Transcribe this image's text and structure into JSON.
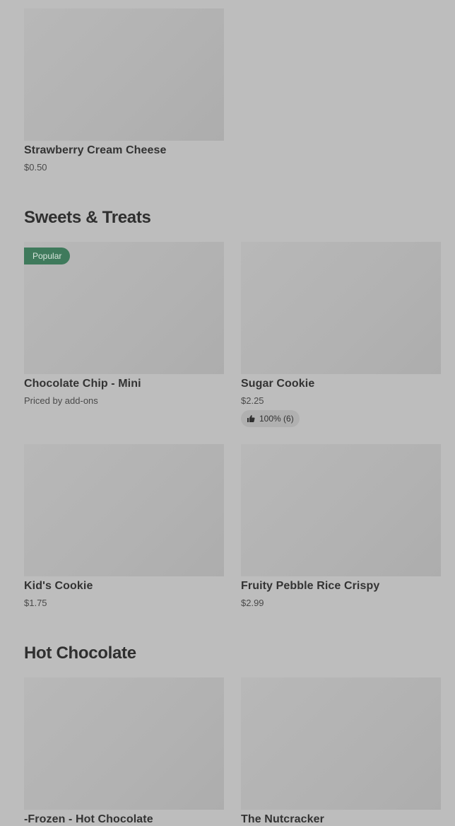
{
  "sections": [
    {
      "title": "Sweets & Treats"
    },
    {
      "title": "Hot Chocolate"
    }
  ],
  "items": {
    "strawberry": {
      "name": "Strawberry Cream Cheese",
      "price": "$0.50"
    },
    "choc_chip": {
      "name": "Chocolate Chip - Mini",
      "price": "Priced by add-ons",
      "badge": "Popular"
    },
    "sugar": {
      "name": "Sugar Cookie",
      "price": "$2.25",
      "rating": "100% (6)"
    },
    "kids": {
      "name": "Kid's Cookie",
      "price": "$1.75"
    },
    "fruity": {
      "name": "Fruity Pebble Rice Crispy",
      "price": "$2.99"
    },
    "frozen": {
      "name": "-Frozen - Hot Chocolate"
    },
    "nutcracker": {
      "name": "The Nutcracker"
    }
  },
  "colors": {
    "background": "#bdbdbd",
    "badge": "#3f7a5c",
    "image_placeholder": "#b2b2b2"
  },
  "icons": {
    "rating": "thumbs-up-icon"
  }
}
